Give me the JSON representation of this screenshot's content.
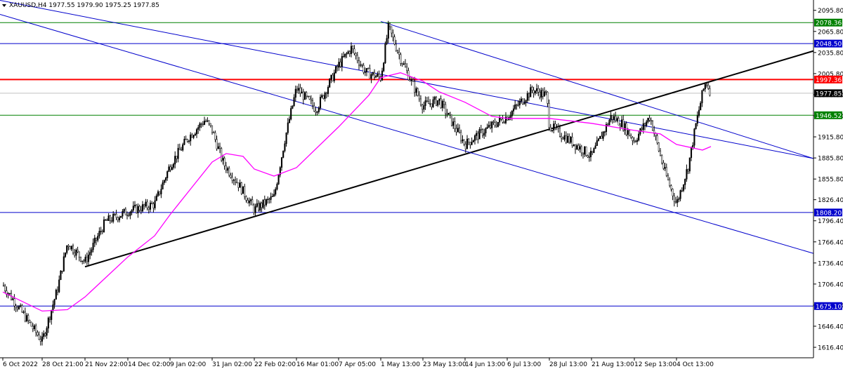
{
  "header": {
    "symbol_line": "XAUUSD,H4  1977.55 1979.90 1975.25 1977.85",
    "menu_icon": "triangle-down-icon"
  },
  "chart_data": {
    "type": "candlestick",
    "title": "",
    "ylim": [
      1601.5,
      2110.5
    ],
    "y_ticks": [
      "2095.80",
      "2065.80",
      "2035.80",
      "2005.80",
      "1975.80",
      "1945.80",
      "1915.80",
      "1885.80",
      "1855.80",
      "1826.40",
      "1796.40",
      "1766.40",
      "1736.40",
      "1706.40",
      "1676.40",
      "1646.40",
      "1616.40"
    ],
    "x_ticks": [
      "6 Oct 2022",
      "28 Oct 21:00",
      "21 Nov 22:00",
      "14 Dec 02:00",
      "9 Jan 02:00",
      "31 Jan 02:00",
      "22 Feb 02:00",
      "16 Mar 01:00",
      "7 Apr 05:00",
      "1 May 13:00",
      "23 May 13:00",
      "14 Jun 13:00",
      "6 Jul 13:00",
      "28 Jul 13:00",
      "21 Aug 13:00",
      "12 Sep 13:00",
      "4 Oct 13:00"
    ],
    "grid": false,
    "current_price": "1977.85",
    "horizontal_levels": [
      {
        "label": "2078.36",
        "color": "#008000"
      },
      {
        "label": "2048.50",
        "color": "#0000cc"
      },
      {
        "label": "1997.36",
        "color": "#ff0000"
      },
      {
        "label": "1946.52",
        "color": "#008000"
      },
      {
        "label": "1808.20",
        "color": "#0000cc"
      },
      {
        "label": "1675.10",
        "color": "#0000cc"
      }
    ],
    "price_path": [
      [
        "6 Oct 2022",
        1705
      ],
      [
        "28 Oct 21:00",
        1625
      ],
      [
        "Nov 3",
        1700
      ],
      [
        "Nov 8",
        1765
      ],
      [
        "21 Nov 22:00",
        1738
      ],
      [
        "Nov 30",
        1795
      ],
      [
        "14 Dec 02:00",
        1810
      ],
      [
        "Dec 28",
        1820
      ],
      [
        "9 Jan 02:00",
        1875
      ],
      [
        "Jan 18",
        1915
      ],
      [
        "Jan 27",
        1940
      ],
      [
        "31 Jan 02:00",
        1925
      ],
      [
        "Feb 6",
        1878
      ],
      [
        "Feb 14",
        1848
      ],
      [
        "22 Feb 02:00",
        1812
      ],
      [
        "Mar 4",
        1830
      ],
      [
        "Mar 9",
        1910
      ],
      [
        "16 Mar 01:00",
        1985
      ],
      [
        "Mar 24",
        1955
      ],
      [
        "7 Apr 05:00",
        2018
      ],
      [
        "Apr 12",
        2042
      ],
      [
        "Apr 19",
        2008
      ],
      [
        "1 May 13:00",
        2000
      ],
      [
        "May 4",
        2072
      ],
      [
        "May 10",
        2028
      ],
      [
        "May 18",
        1985
      ],
      [
        "23 May 13:00",
        1960
      ],
      [
        "Jun 1",
        1968
      ],
      [
        "14 Jun 13:00",
        1905
      ],
      [
        "Jun 22",
        1925
      ],
      [
        "6 Jul 13:00",
        1945
      ],
      [
        "Jul 12",
        1983
      ],
      [
        "Jul 20",
        1975
      ],
      [
        "28 Jul 13:00",
        1932
      ],
      [
        "21 Aug 13:00",
        1888
      ],
      [
        "Aug 28",
        1945
      ],
      [
        "Sep 4",
        1935
      ],
      [
        "12 Sep 13:00",
        1910
      ],
      [
        "Sep 20",
        1945
      ],
      [
        "Sep 27",
        1870
      ],
      [
        "4 Oct 13:00",
        1820
      ],
      [
        "Oct 9",
        1875
      ],
      [
        "Oct 13",
        1930
      ],
      [
        "Oct 18",
        1978
      ],
      [
        "Oct 20",
        1995
      ],
      [
        "Oct 23",
        1977.85
      ]
    ],
    "series": [
      {
        "color": "#ff00ff",
        "path": [
          [
            "6 Oct 2022",
            1695
          ],
          [
            "28 Oct 21:00",
            1668
          ],
          [
            "Nov 8",
            1670
          ],
          [
            "21 Nov 22:00",
            1688
          ],
          [
            "14 Dec 02:00",
            1745
          ],
          [
            "Dec 28",
            1775
          ],
          [
            "9 Jan 02:00",
            1805
          ],
          [
            "Jan 20",
            1845
          ],
          [
            "31 Jan 02:00",
            1880
          ],
          [
            "Feb 8",
            1892
          ],
          [
            "Feb 16",
            1888
          ],
          [
            "22 Feb 02:00",
            1870
          ],
          [
            "Mar 4",
            1860
          ],
          [
            "16 Mar 01:00",
            1872
          ],
          [
            "7 Apr 05:00",
            1930
          ],
          [
            "Apr 20",
            1975
          ],
          [
            "1 May 13:00",
            2000
          ],
          [
            "May 10",
            2007
          ],
          [
            "23 May 13:00",
            1995
          ],
          [
            "Jun 1",
            1980
          ],
          [
            "14 Jun 13:00",
            1965
          ],
          [
            "Jun 24",
            1945
          ],
          [
            "6 Jul 13:00",
            1942
          ],
          [
            "28 Jul 13:00",
            1942
          ],
          [
            "21 Aug 13:00",
            1935
          ],
          [
            "12 Sep 13:00",
            1925
          ],
          [
            "Sep 25",
            1920
          ],
          [
            "4 Oct 13:00",
            1905
          ],
          [
            "Oct 18",
            1897
          ],
          [
            "Oct 23",
            1902
          ]
        ]
      }
    ],
    "trendlines": [
      {
        "color": "#000000",
        "from": [
          "21 Nov 22:00",
          1731
        ],
        "to": [
          "end",
          2038
        ]
      },
      {
        "color": "#0000cc",
        "from": [
          "start",
          2110
        ],
        "to": [
          "end",
          1885
        ]
      },
      {
        "color": "#0000cc",
        "from": [
          "1 May 13:00",
          2080
        ],
        "to": [
          "end",
          1885
        ]
      },
      {
        "color": "#0000cc",
        "from": [
          "start",
          2090
        ],
        "to": [
          "end",
          1750
        ]
      }
    ]
  }
}
